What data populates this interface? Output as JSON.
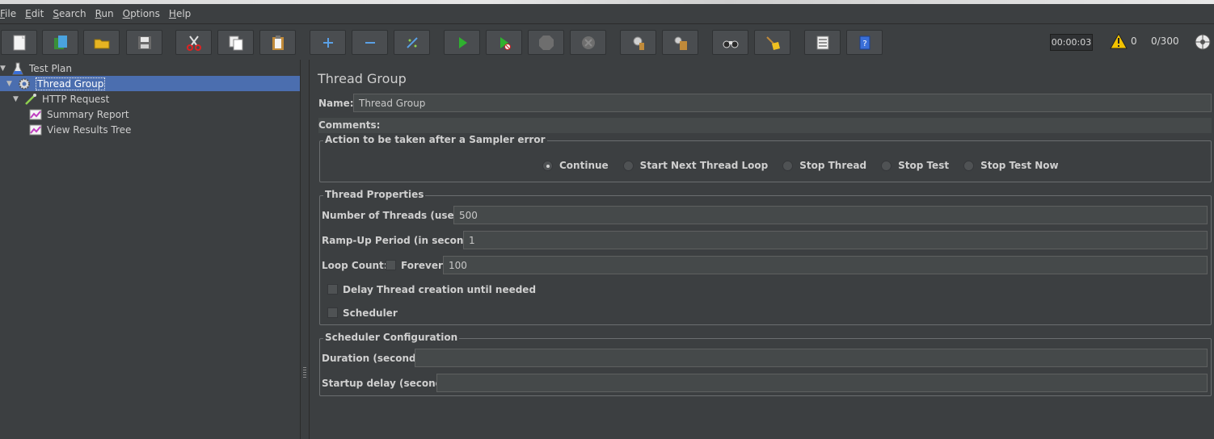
{
  "menu": [
    {
      "label": "File",
      "mnemonic": "F",
      "rest": "ile"
    },
    {
      "label": "Edit",
      "mnemonic": "E",
      "rest": "dit"
    },
    {
      "label": "Search",
      "mnemonic": "S",
      "rest": "earch"
    },
    {
      "label": "Run",
      "mnemonic": "R",
      "rest": "un"
    },
    {
      "label": "Options",
      "mnemonic": "O",
      "rest": "ptions"
    },
    {
      "label": "Help",
      "mnemonic": "H",
      "rest": "elp"
    }
  ],
  "toolbar": {
    "timer": "00:00:03",
    "warnings": "0",
    "threads": "0/300"
  },
  "tree": {
    "items": [
      {
        "label": "Test Plan"
      },
      {
        "label": "Thread Group"
      },
      {
        "label": "HTTP Request"
      },
      {
        "label": "Summary Report"
      },
      {
        "label": "View Results Tree"
      }
    ]
  },
  "panel": {
    "title": "Thread Group",
    "name_label": "Name:",
    "name_value": "Thread Group",
    "comments_label": "Comments:",
    "sampler_error": {
      "legend": "Action to be taken after a Sampler error",
      "options": [
        "Continue",
        "Start Next Thread Loop",
        "Stop Thread",
        "Stop Test",
        "Stop Test Now"
      ],
      "selected": "Continue"
    },
    "thread_props": {
      "legend": "Thread Properties",
      "threads_label": "Number of Threads (users):",
      "threads_value": "500",
      "rampup_label": "Ramp-Up Period (in seconds):",
      "rampup_value": "1",
      "loop_label": "Loop Count:",
      "forever_label": "Forever",
      "loop_value": "100",
      "delay_label": "Delay Thread creation until needed",
      "scheduler_label": "Scheduler"
    },
    "scheduler_config": {
      "legend": "Scheduler Configuration",
      "duration_label": "Duration (seconds)",
      "duration_value": "",
      "startup_label": "Startup delay (seconds)",
      "startup_value": ""
    }
  },
  "colors": {
    "background": "#3c3f41",
    "selection": "#4b6eaf",
    "field": "#45494a"
  }
}
